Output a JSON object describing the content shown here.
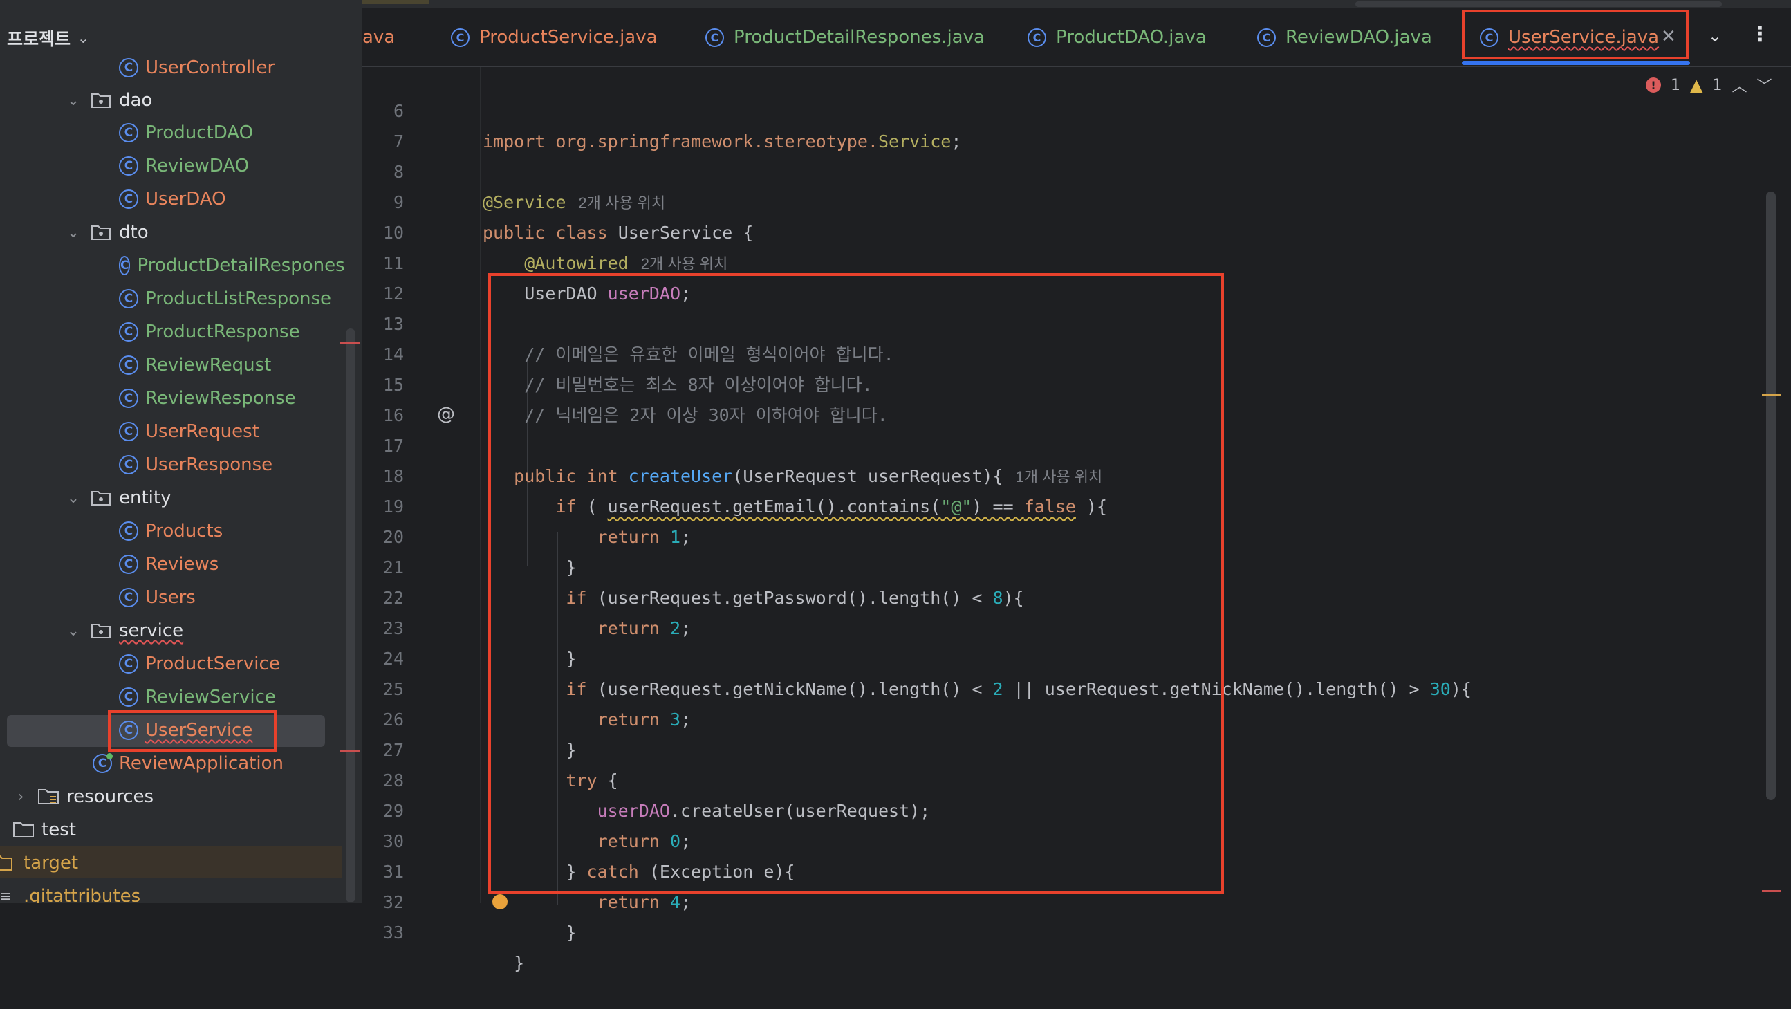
{
  "project": {
    "title": "프로젝트"
  },
  "tree": [
    {
      "label": "UserController",
      "kind": "class",
      "color": "orange"
    },
    {
      "label": "dao",
      "kind": "package"
    },
    {
      "label": "ProductDAO",
      "kind": "class",
      "color": "green"
    },
    {
      "label": "ReviewDAO",
      "kind": "class",
      "color": "green"
    },
    {
      "label": "UserDAO",
      "kind": "class",
      "color": "orange"
    },
    {
      "label": "dto",
      "kind": "package"
    },
    {
      "label": "ProductDetailRespones",
      "kind": "class",
      "color": "green"
    },
    {
      "label": "ProductListResponse",
      "kind": "class",
      "color": "green"
    },
    {
      "label": "ProductResponse",
      "kind": "class",
      "color": "green"
    },
    {
      "label": "ReviewRequst",
      "kind": "class",
      "color": "green"
    },
    {
      "label": "ReviewResponse",
      "kind": "class",
      "color": "green"
    },
    {
      "label": "UserRequest",
      "kind": "class",
      "color": "orange"
    },
    {
      "label": "UserResponse",
      "kind": "class",
      "color": "orange"
    },
    {
      "label": "entity",
      "kind": "package"
    },
    {
      "label": "Products",
      "kind": "class",
      "color": "orange"
    },
    {
      "label": "Reviews",
      "kind": "class",
      "color": "orange"
    },
    {
      "label": "Users",
      "kind": "class",
      "color": "orange"
    },
    {
      "label": "service",
      "kind": "package"
    },
    {
      "label": "ProductService",
      "kind": "class",
      "color": "orange"
    },
    {
      "label": "ReviewService",
      "kind": "class",
      "color": "green"
    },
    {
      "label": "UserService",
      "kind": "class",
      "color": "orange",
      "selected": true
    },
    {
      "label": "ReviewApplication",
      "kind": "app",
      "color": "orange"
    },
    {
      "label": "resources",
      "kind": "folder"
    },
    {
      "label": "test",
      "kind": "folder"
    },
    {
      "label": "target",
      "kind": "folder-target"
    },
    {
      "label": ".gitattributes",
      "kind": "file"
    }
  ],
  "tabs": [
    {
      "label": "ava",
      "color": "orange"
    },
    {
      "label": "ProductService.java",
      "color": "orange"
    },
    {
      "label": "ProductDetailRespones.java",
      "color": "green"
    },
    {
      "label": "ProductDAO.java",
      "color": "green"
    },
    {
      "label": "ReviewDAO.java",
      "color": "green"
    },
    {
      "label": "UserService.java",
      "color": "orange",
      "active": true
    }
  ],
  "inspections": {
    "errors": "1",
    "warnings": "1"
  },
  "code": {
    "l6": {
      "n": "6",
      "a": "import org.springframework.stereotype.",
      "b": "Service",
      "c": ";"
    },
    "l7": {
      "n": "7"
    },
    "l8": {
      "n": "8",
      "ann": "@Service",
      "hint": "2개 사용 위치"
    },
    "l9": {
      "n": "9",
      "kw1": "public",
      "kw2": "class",
      "name": "UserService {"
    },
    "l10": {
      "n": "10",
      "ann": "@Autowired",
      "hint": "2개 사용 위치"
    },
    "l11": {
      "n": "11",
      "type": "UserDAO ",
      "field": "userDAO",
      "end": ";"
    },
    "l12": {
      "n": "12"
    },
    "l13": {
      "n": "13",
      "cmt": "// 이메일은 유효한 이메일 형식이어야 합니다."
    },
    "l14": {
      "n": "14",
      "cmt": "// 비밀번호는 최소 8자 이상이어야 합니다."
    },
    "l15": {
      "n": "15",
      "cmt": "// 닉네임은 2자 이상 30자 이하여야 합니다."
    },
    "l16": {
      "n": "16"
    },
    "l17": {
      "n": "17",
      "kw1": "public",
      "kw2": "int",
      "fn": "createUser",
      "rest": "(UserRequest userRequest){",
      "hint": "1개 사용 위치"
    },
    "l18": {
      "n": "18",
      "kw": "if",
      "a": " ( ",
      "b": "userRequest.getEmail().contains(",
      "str": "\"@\"",
      "c": ") == ",
      "kw2": "false",
      "d": " ){"
    },
    "l19": {
      "n": "19",
      "kw": "return",
      "num": "1",
      "end": ";"
    },
    "l20": {
      "n": "20",
      "t": "}"
    },
    "l21": {
      "n": "21",
      "kw": "if",
      "a": " (userRequest.getPassword().length() < ",
      "num": "8",
      "end": "){"
    },
    "l22": {
      "n": "22",
      "kw": "return",
      "num": "2",
      "end": ";"
    },
    "l23": {
      "n": "23",
      "t": "}"
    },
    "l24": {
      "n": "24",
      "kw": "if",
      "a": " (userRequest.getNickName().length() < ",
      "num1": "2",
      "b": " || userRequest.getNickName().length() > ",
      "num2": "30",
      "end": "){"
    },
    "l25": {
      "n": "25",
      "kw": "return",
      "num": "3",
      "end": ";"
    },
    "l26": {
      "n": "26",
      "t": "}"
    },
    "l27": {
      "n": "27",
      "kw": "try",
      "end": " {"
    },
    "l28": {
      "n": "28",
      "field": "userDAO",
      "rest": ".createUser(userRequest);"
    },
    "l29": {
      "n": "29",
      "kw": "return",
      "num": "0",
      "end": ";"
    },
    "l30": {
      "n": "30",
      "a": "} ",
      "kw": "catch",
      "b": " (Exception e){"
    },
    "l31": {
      "n": "31",
      "kw": "return",
      "num": "4",
      "end": ";"
    },
    "l32": {
      "n": "32",
      "t": "}"
    },
    "l33": {
      "n": "33",
      "t": "}"
    }
  },
  "colors": {
    "highlight": "#e8412c",
    "accent": "#3574f0",
    "background": "#1e1f22"
  }
}
